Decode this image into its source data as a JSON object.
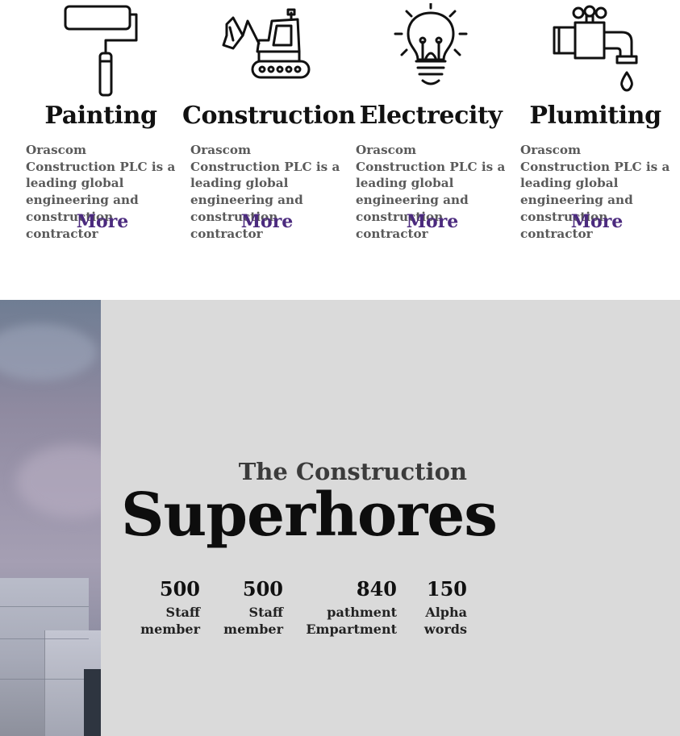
{
  "services": [
    {
      "title": "Painting",
      "description": "Orascom Construction PLC is a leading global engineering and construction contractor",
      "more": "More",
      "icon": "paint-roller-icon"
    },
    {
      "title": "Construction",
      "description": "Orascom Construction PLC is a leading global engineering and construction contractor",
      "more": "More",
      "icon": "excavator-icon"
    },
    {
      "title": "Electrecity",
      "description": "Orascom Construction PLC is a leading global engineering and construction contractor",
      "more": "More",
      "icon": "light-bulb-icon"
    },
    {
      "title": "Plumiting",
      "description": "Orascom Construction PLC is a leading global engineering and construction contractor",
      "more": "More",
      "icon": "water-faucet-icon"
    }
  ],
  "hero": {
    "subtitle": "The Construction",
    "title": "Superhores",
    "stats": [
      {
        "value": "500",
        "label_line1": "Staff",
        "label_line2": "member"
      },
      {
        "value": "500",
        "label_line1": "Staff",
        "label_line2": "member"
      },
      {
        "value": "840",
        "label_line1": "pathment",
        "label_line2": "Empartment"
      },
      {
        "value": "150",
        "label_line1": "Alpha",
        "label_line2": "words"
      }
    ]
  },
  "colors": {
    "accent": "#4b2a7e",
    "hero_bg": "#dadada",
    "desc_text": "#5a5a5a"
  }
}
